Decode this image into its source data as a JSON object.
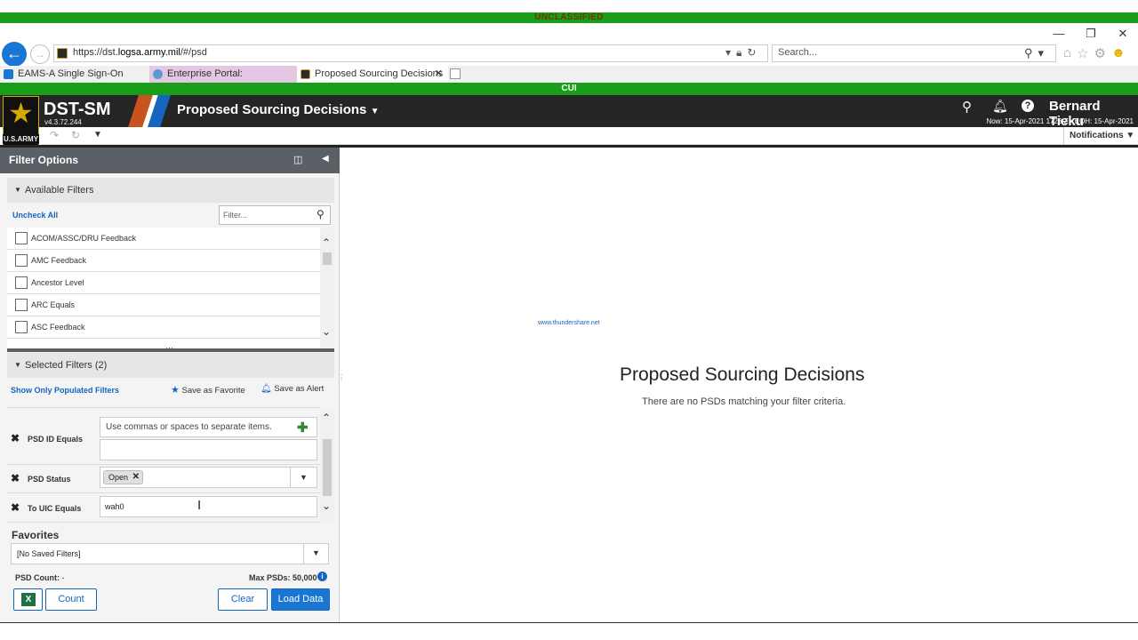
{
  "banners": {
    "top": "UNCLASSIFIED",
    "cui": "CUI"
  },
  "browser": {
    "url_prefix": "https://dst.",
    "url_domain": "logsa.army.mil",
    "url_suffix": "/#/psd",
    "search_placeholder": "Search...",
    "tabs": [
      {
        "label": "EAMS-A Single Sign-On"
      },
      {
        "label": "Enterprise Portal:"
      },
      {
        "label": "Proposed Sourcing Decisions"
      }
    ]
  },
  "app": {
    "logo_text": "U.S.ARMY",
    "name": "DST-SM",
    "version": "v4.3.72.244",
    "page_title": "Proposed Sourcing Decisions",
    "user_name": "Bernard Tieku",
    "now_eoh": "Now: 15-Apr-2021 1723 Z • EOH: 15-Apr-2021",
    "notifications_label": "Notifications"
  },
  "filter_panel": {
    "title": "Filter Options",
    "available_filters": {
      "header": "Available Filters",
      "uncheck_all": "Uncheck All",
      "filter_placeholder": "Filter...",
      "items": [
        "ACOM/ASSC/DRU Feedback",
        "AMC Feedback",
        "Ancestor Level",
        "ARC Equals",
        "ASC Feedback"
      ]
    },
    "selected_filters": {
      "header": "Selected Filters (2)",
      "show_only_populated": "Show Only Populated Filters",
      "save_favorite": "Save as Favorite",
      "save_alert": "Save as Alert",
      "psd_id": {
        "label": "PSD ID Equals",
        "placeholder": "Use commas or spaces to separate items."
      },
      "psd_status": {
        "label": "PSD Status",
        "chip": "Open"
      },
      "to_uic": {
        "label": "To UIC Equals",
        "value": "wah0"
      }
    },
    "favorites": {
      "title": "Favorites",
      "selected": "[No Saved Filters]"
    },
    "psd_count_label": "PSD Count:",
    "psd_count_value": "-",
    "max_psds": "Max PSDs: 50,000",
    "buttons": {
      "count": "Count",
      "clear": "Clear",
      "load": "Load Data"
    }
  },
  "main": {
    "watermark": "www.thundershare.net",
    "title": "Proposed Sourcing Decisions",
    "message": "There are no PSDs matching your filter criteria."
  }
}
